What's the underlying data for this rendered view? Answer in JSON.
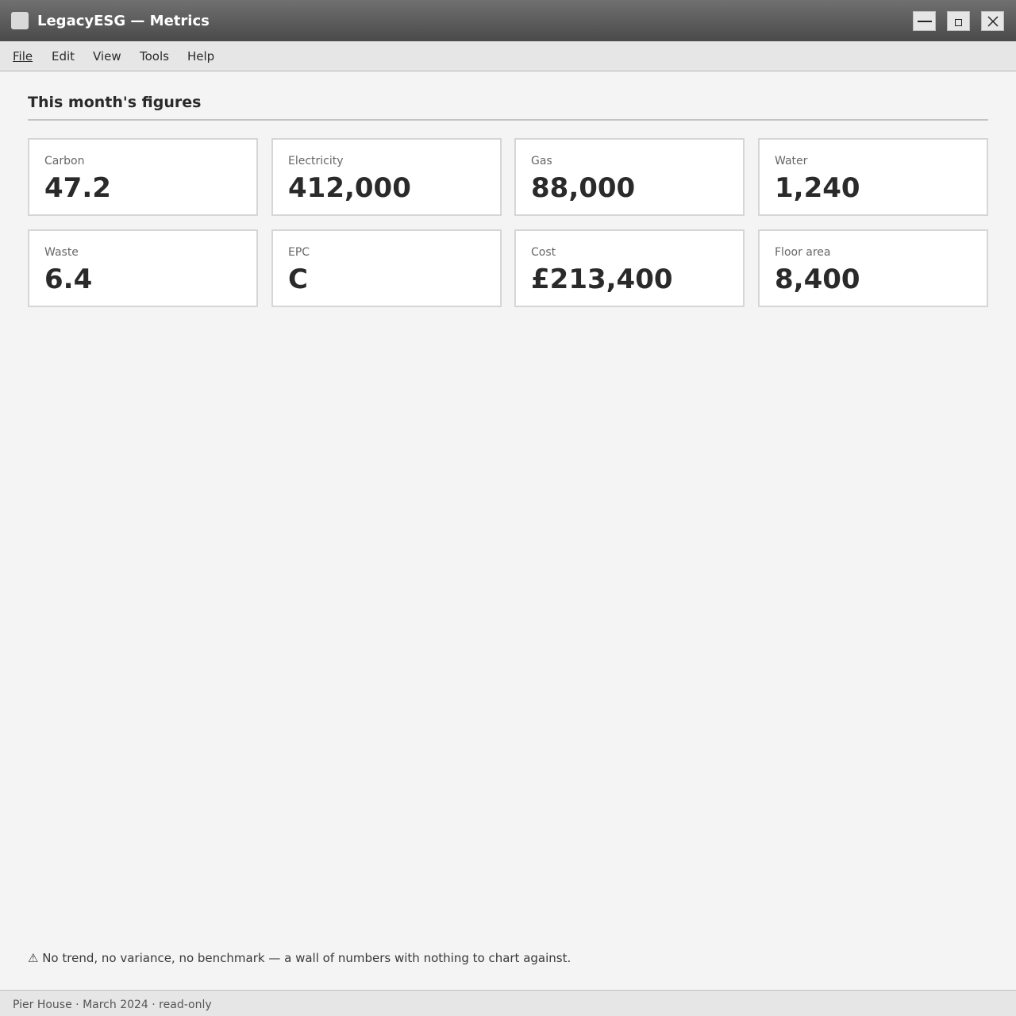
{
  "window": {
    "title": "LegacyESG — Metrics",
    "controls": {
      "minimize_icon": "minimize-icon",
      "maximize_icon": "maximize-icon",
      "close_icon": "close-icon"
    }
  },
  "menu": [
    "File",
    "Edit",
    "View",
    "Tools",
    "Help"
  ],
  "section": {
    "title": "This month's figures"
  },
  "metrics": [
    {
      "label": "Carbon",
      "value": "47.2"
    },
    {
      "label": "Electricity",
      "value": "412,000"
    },
    {
      "label": "Gas",
      "value": "88,000"
    },
    {
      "label": "Water",
      "value": "1,240"
    },
    {
      "label": "Waste",
      "value": "6.4"
    },
    {
      "label": "EPC",
      "value": "C"
    },
    {
      "label": "Cost",
      "value": "£213,400"
    },
    {
      "label": "Floor area",
      "value": "8,400"
    }
  ],
  "warning": {
    "icon": "warning-icon",
    "text": "⚠ No trend, no variance, no benchmark — a wall of numbers with nothing to chart against."
  },
  "status": {
    "text": "Pier House · March 2024 · read-only"
  }
}
